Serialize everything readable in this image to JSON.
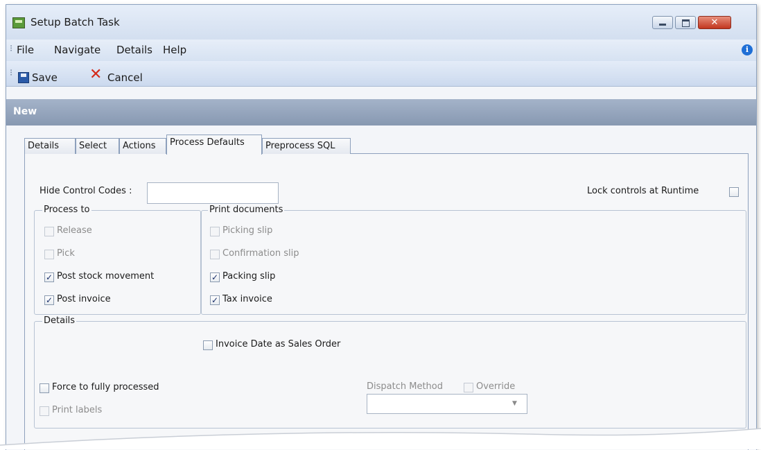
{
  "window": {
    "title": "Setup Batch Task",
    "close_glyph": "✕"
  },
  "menu": {
    "items": [
      "File",
      "Navigate",
      "Details",
      "Help"
    ],
    "grip": "⁝"
  },
  "toolbar": {
    "save_label": "Save",
    "cancel_label": "Cancel",
    "cancel_glyph": "✕",
    "grip": "⁝"
  },
  "header": {
    "title": "New"
  },
  "tabs": [
    "Details",
    "Select",
    "Actions",
    "Process Defaults",
    "Preprocess SQL"
  ],
  "active_tab": "Process Defaults",
  "form": {
    "hide_control_codes_label": "Hide Control Codes :",
    "hide_control_codes_value": "",
    "lock_controls_label": "Lock controls at Runtime",
    "lock_controls_checked": false,
    "process_to": {
      "title": "Process to",
      "items": [
        {
          "label": "Release",
          "checked": false,
          "enabled": false
        },
        {
          "label": "Pick",
          "checked": false,
          "enabled": false
        },
        {
          "label": "Post stock movement",
          "checked": true,
          "enabled": true
        },
        {
          "label": "Post invoice",
          "checked": true,
          "enabled": true
        }
      ]
    },
    "print_documents": {
      "title": "Print documents",
      "items": [
        {
          "label": "Picking slip",
          "checked": false,
          "enabled": false
        },
        {
          "label": "Confirmation slip",
          "checked": false,
          "enabled": false
        },
        {
          "label": "Packing slip",
          "checked": true,
          "enabled": true
        },
        {
          "label": "Tax invoice",
          "checked": true,
          "enabled": true
        }
      ]
    },
    "details": {
      "title": "Details",
      "invoice_date_label": "Invoice Date as Sales Order",
      "invoice_date_checked": false,
      "force_label": "Force to fully processed",
      "force_checked": false,
      "print_labels_label": "Print labels",
      "print_labels_checked": false,
      "dispatch_method_label": "Dispatch Method",
      "override_label": "Override",
      "override_checked": false,
      "dispatch_method_value": ""
    }
  },
  "colors": {
    "accent": "#1f6fd6",
    "header_bg": "#97a7bf",
    "close_button": "#c84a33"
  },
  "check_glyph": "✓",
  "dropdown_glyph": "▼",
  "info_glyph": "i"
}
